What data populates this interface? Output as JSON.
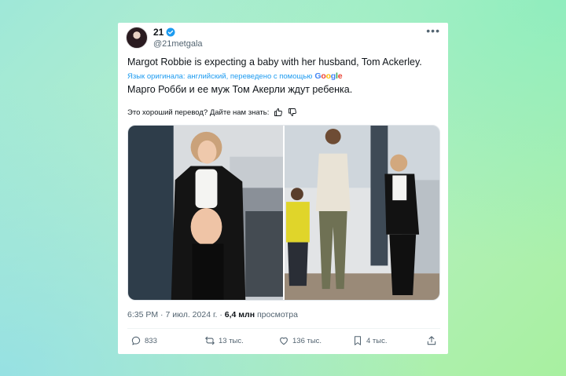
{
  "author": {
    "name": "21",
    "handle": "@21metgala"
  },
  "tweet": {
    "text_original": "Margot Robbie is expecting a baby with her husband, Tom Ackerley.",
    "translation_note": "Язык оригинала: английский, переведено с помощью",
    "translation_provider": "Google",
    "text_translated": "Марго Робби и ее муж Том Акерли ждут ребенка.",
    "feedback_prompt": "Это хороший перевод? Дайте нам знать:"
  },
  "meta": {
    "time": "6:35 PM",
    "separator": " · ",
    "date": "7 июл. 2024 г.",
    "views": "6,4 млн",
    "views_label": "просмотра"
  },
  "actions": {
    "replies": "833",
    "reposts": "13 тыс.",
    "likes": "136 тыс.",
    "bookmarks": "4 тыс."
  },
  "colors": {
    "accent": "#1d9bf0",
    "text": "#0f1419",
    "muted": "#536471"
  },
  "icons": [
    "more-icon",
    "verified-icon",
    "thumbs-up-icon",
    "thumbs-down-icon",
    "reply-icon",
    "repost-icon",
    "like-icon",
    "bookmark-icon",
    "share-icon"
  ]
}
